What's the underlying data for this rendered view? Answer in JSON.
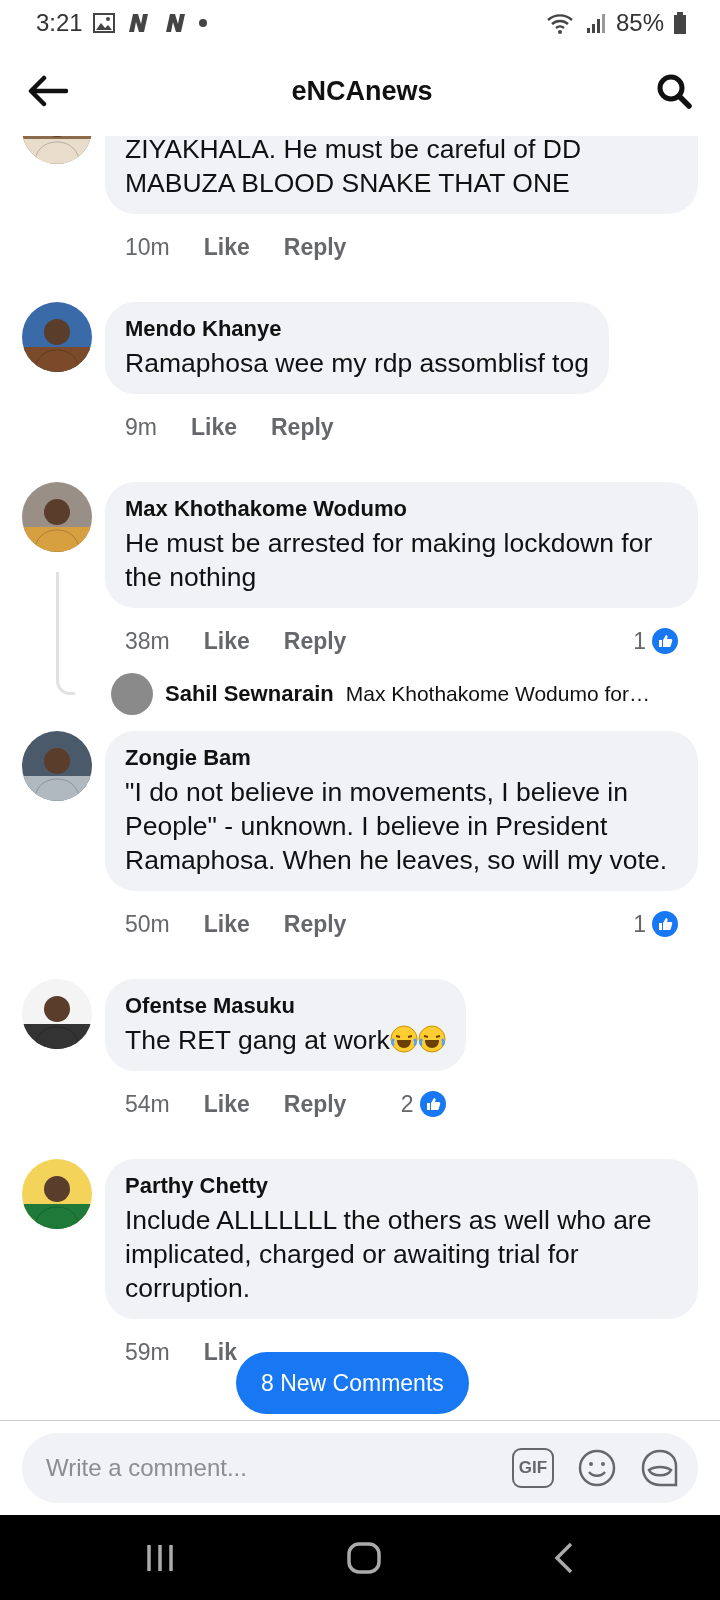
{
  "status_bar": {
    "time": "3:21",
    "battery": "85%"
  },
  "header": {
    "title": "eNCAnews"
  },
  "comments": [
    {
      "kind": "partial",
      "text": "ZIYAKHALA. He must be careful of DD MABUZA BLOOD SNAKE THAT ONE",
      "time": "10m",
      "like": "Like",
      "reply": "Reply"
    },
    {
      "kind": "full",
      "name": "Mendo Khanye",
      "text": "Ramaphosa wee my rdp assomblisf tog",
      "time": "9m",
      "like": "Like",
      "reply": "Reply"
    },
    {
      "kind": "full",
      "name": "Max Khothakome Wodumo",
      "text": "He must be arrested for making lockdown for the nothing",
      "time": "38m",
      "like": "Like",
      "reply": "Reply",
      "reactions": "1",
      "replies": [
        {
          "name": "Sahil Sewnarain",
          "text": "Max Khothakome Wodumo for…"
        }
      ]
    },
    {
      "kind": "full",
      "name": "Zongie Bam",
      "text": "\"I do not believe in movements, I believe in People\" - unknown. I believe in President Ramaphosa. When he leaves, so will my vote.",
      "time": "50m",
      "like": "Like",
      "reply": "Reply",
      "reactions": "1"
    },
    {
      "kind": "full",
      "name": "Ofentse Masuku",
      "text": "The RET gang at work",
      "trailing_icons": [
        {
          "kind": "laughing"
        },
        {
          "kind": "laughing"
        }
      ],
      "time": "54m",
      "like": "Like",
      "reply": "Reply",
      "reactions": "2"
    },
    {
      "kind": "full",
      "name": "Parthy Chetty",
      "text": "Include ALLLLLLL the others as well who are implicated, charged or awaiting trial for corruption.",
      "time": "59m",
      "like": "Lik"
    }
  ],
  "new_comments_button": "8 New Comments",
  "composer": {
    "placeholder": "Write a comment...",
    "gif": "GIF"
  }
}
